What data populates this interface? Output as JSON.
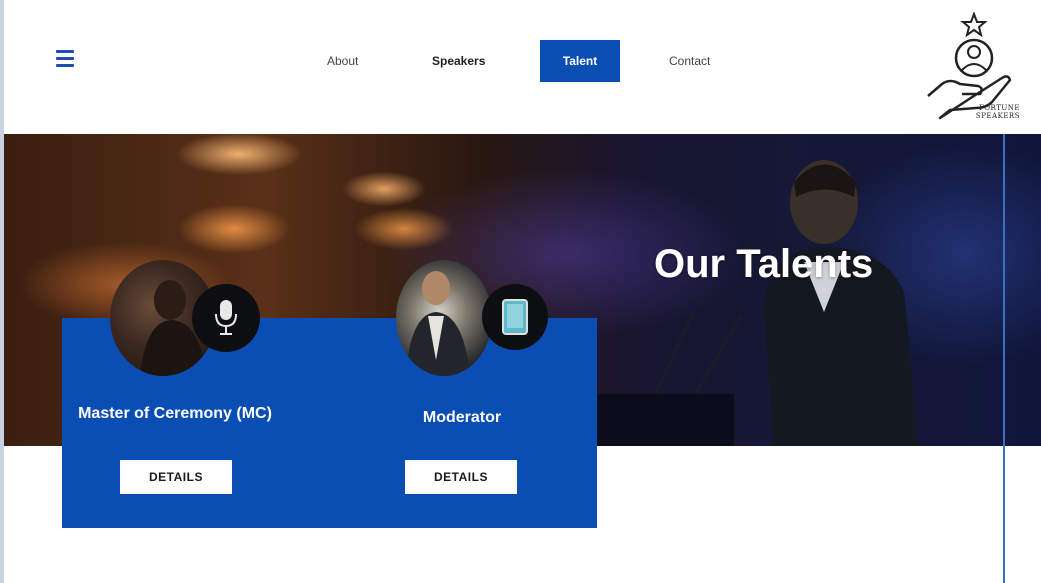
{
  "header": {
    "menu_icon": "hamburger-menu-icon",
    "nav": {
      "about": "About",
      "speakers": "Speakers",
      "talent": "Talent",
      "contact": "Contact"
    },
    "active_nav": "Talent",
    "logo": {
      "line1": "FORTUNE",
      "line2": "SPEAKERS",
      "icon": "hand-person-star-icon"
    }
  },
  "hero": {
    "title": "Our Talents"
  },
  "talents": [
    {
      "title": "Master of Ceremony (MC)",
      "icon": "microphone-icon",
      "button": "DETAILS"
    },
    {
      "title": "Moderator",
      "icon": "tablet-icon",
      "button": "DETAILS"
    }
  ],
  "colors": {
    "brand_blue": "#0a4eb3",
    "text_white": "#ffffff",
    "accent_line": "#3b6fbf"
  }
}
